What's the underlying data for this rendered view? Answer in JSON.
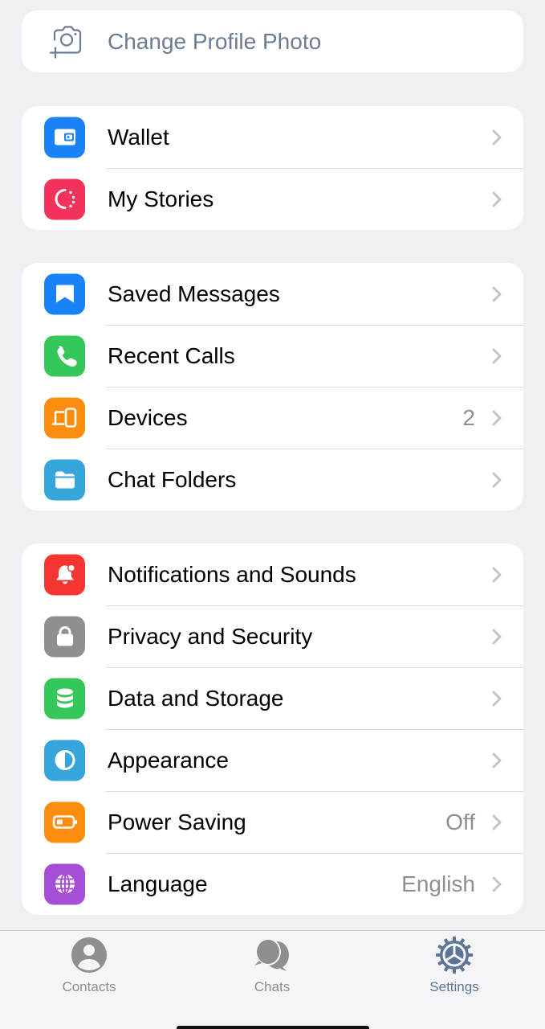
{
  "profile": {
    "change_photo_label": "Change Profile Photo"
  },
  "group1": [
    {
      "label": "Wallet",
      "icon": "wallet-icon",
      "color": "#1a82f7",
      "value": ""
    },
    {
      "label": "My Stories",
      "icon": "stories-icon",
      "color": "#f2325a",
      "value": ""
    }
  ],
  "group2": [
    {
      "label": "Saved Messages",
      "icon": "bookmark-icon",
      "color": "#1a82f7",
      "value": ""
    },
    {
      "label": "Recent Calls",
      "icon": "phone-icon",
      "color": "#35c759",
      "value": ""
    },
    {
      "label": "Devices",
      "icon": "devices-icon",
      "color": "#fd8d0e",
      "value": "2"
    },
    {
      "label": "Chat Folders",
      "icon": "folder-icon",
      "color": "#35a5dc",
      "value": ""
    }
  ],
  "group3": [
    {
      "label": "Notifications and Sounds",
      "icon": "bell-icon",
      "color": "#f5352f",
      "value": ""
    },
    {
      "label": "Privacy and Security",
      "icon": "lock-icon",
      "color": "#8e8e93",
      "value": ""
    },
    {
      "label": "Data and Storage",
      "icon": "database-icon",
      "color": "#35c759",
      "value": ""
    },
    {
      "label": "Appearance",
      "icon": "appearance-icon",
      "color": "#35a5dc",
      "value": ""
    },
    {
      "label": "Power Saving",
      "icon": "battery-icon",
      "color": "#fd8d0e",
      "value": "Off"
    },
    {
      "label": "Language",
      "icon": "globe-icon",
      "color": "#a54ed8",
      "value": "English"
    }
  ],
  "tabbar": {
    "tabs": [
      {
        "label": "Contacts",
        "active": false
      },
      {
        "label": "Chats",
        "active": false
      },
      {
        "label": "Settings",
        "active": true
      }
    ],
    "inactive_color": "#8e8e93",
    "active_color": "#5c7597"
  }
}
